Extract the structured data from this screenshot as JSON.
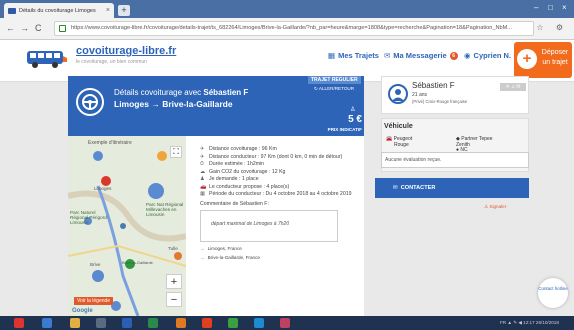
{
  "browser": {
    "tab_title": "Détails du covoiturage Limoges",
    "tab_close": "×",
    "new_tab": "+",
    "url": "https://www.covoiturage-libre.fr/covoiturage/details-trajet/ts_682264/Limoges/Brive-la-Gaillarde/?nb_par=heure&marge=1808&type=recherche&Pagination=18&Pagination_NbM...",
    "back": "←",
    "forward": "→",
    "reload": "C",
    "addr_icons": "☆ ⚙",
    "minimize": "–",
    "maximize": "□",
    "close": "×"
  },
  "site": {
    "brand": "covoiturage-libre.fr",
    "tagline": "le covoiturage, un bien commun",
    "nav": {
      "mes_trajets": "Mes Trajets",
      "messagerie": "Ma Messagerie",
      "messagerie_count": "6",
      "user": "Cyprien N."
    },
    "deposer_label": "Déposer un trajet",
    "deposer_plus": "+"
  },
  "trip": {
    "title_prefix": "Détails covoiturage avec",
    "driver": "Sébastien F",
    "from": "Limoges",
    "arrow": "→",
    "to": "Brive-la-Gaillarde",
    "regular_badge": "TRAJET REGULIER",
    "round_trip": "ALLER/RETOUR",
    "price": "5 €",
    "price_label": "PRIX INDICATIF"
  },
  "map": {
    "example_label": "Exemple d'itinéraire",
    "places": [
      "Limoges",
      "Parc Naturel Régional Périgord-Limousin",
      "Parc Nat Régional Millevaches en Limousin",
      "Brive-la-Gaillarde",
      "Tulle",
      "Brive"
    ],
    "zoom_in": "+",
    "zoom_out": "−",
    "fullscreen": "⛶",
    "legend_button": "Voir la légende",
    "google": "Google"
  },
  "details": {
    "rows": [
      {
        "icon": "✈",
        "text": "Distance covoiturage : 96 Km"
      },
      {
        "icon": "✈",
        "text": "Distance conducteur : 97 Km (dont 0 km, 0 min de détour)"
      },
      {
        "icon": "⏱",
        "text": "Durée estimée : 1h2min"
      },
      {
        "icon": "☁",
        "text": "Gain CO2 du covoiturage : 12 Kg"
      },
      {
        "icon": "♟",
        "text": "Je demande : 1 place"
      },
      {
        "icon": "🚗",
        "text": "Le conducteur propose : 4 place(s)"
      },
      {
        "icon": "▦",
        "text": "Période du conducteur : Du 4 octobre 2018 au 4 octobre 2019"
      }
    ],
    "comment_label": "Commentaire de Sébastien F:",
    "comment_text": "départ maximal de Limoges à 7h20",
    "stops": [
      {
        "arrow": "→",
        "text": "Limoges, France"
      },
      {
        "arrow": "→",
        "text": "Brive-la-Gaillarde, France"
      }
    ]
  },
  "driver_card": {
    "name": "Sébastien F",
    "age": "21 ans",
    "nationality": "(Privé) Croix-Rouge française",
    "prefs": "✕ ♫ ✉"
  },
  "vehicle": {
    "title": "Véhicule",
    "make": "Peugeot",
    "color": "Rouge",
    "pref1": "Partner Tepee",
    "pref2": "Zenith",
    "pref3": "NC",
    "no_eval": "Aucune évaluation reçue."
  },
  "actions": {
    "contacter": "CONTACTER",
    "signaler": "Signaler",
    "hotline": "Contact hotline"
  },
  "taskbar": {
    "tray": "FR ▲ ✎ ◀ 12:17  26/10/2018"
  },
  "colors": {
    "brand_blue": "#2d64b8",
    "accent_orange": "#f26b1d",
    "alert_red": "#e05a2a",
    "taskbar": "#1f3250"
  }
}
